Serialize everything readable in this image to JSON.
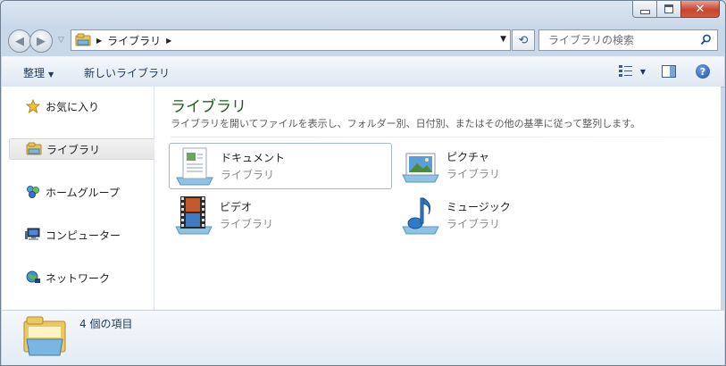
{
  "window": {
    "minimize_icon": "minimize-icon",
    "maximize_icon": "maximize-icon",
    "close_icon": "close-icon",
    "close_glyph": "✕"
  },
  "navbar": {
    "back_glyph": "◀",
    "forward_glyph": "▶",
    "recent_glyph": "▽",
    "address_arrow": "▶",
    "address_path": "ライブラリ",
    "address_trailing_arrow": "▶",
    "address_dropdown": "▼",
    "refresh_glyph": "⟲",
    "search_placeholder": "ライブラリの検索"
  },
  "commandbar": {
    "organize": "整理",
    "organize_caret": "▼",
    "new_library": "新しいライブラリ",
    "view_caret": "▼",
    "help": "?"
  },
  "navpane": {
    "items": [
      {
        "label": "お気に入り",
        "icon": "star-icon"
      },
      {
        "label": "ライブラリ",
        "icon": "library-icon"
      },
      {
        "label": "ホームグループ",
        "icon": "homegroup-icon"
      },
      {
        "label": "コンピューター",
        "icon": "computer-icon"
      },
      {
        "label": "ネットワーク",
        "icon": "network-icon"
      }
    ]
  },
  "content": {
    "title": "ライブラリ",
    "description": "ライブラリを開いてファイルを表示し、フォルダー別、日付別、またはその他の基準に従って整列します。",
    "tiles": [
      {
        "name": "ドキュメント",
        "sub": "ライブラリ",
        "icon": "documents-icon"
      },
      {
        "name": "ピクチャ",
        "sub": "ライブラリ",
        "icon": "pictures-icon"
      },
      {
        "name": "ビデオ",
        "sub": "ライブラリ",
        "icon": "videos-icon"
      },
      {
        "name": "ミュージック",
        "sub": "ライブラリ",
        "icon": "music-icon"
      }
    ]
  },
  "details": {
    "item_count": "4 個の項目"
  },
  "colors": {
    "title_green": "#1e5f17",
    "accent_blue": "#1e395b",
    "close_red": "#c8452c"
  }
}
